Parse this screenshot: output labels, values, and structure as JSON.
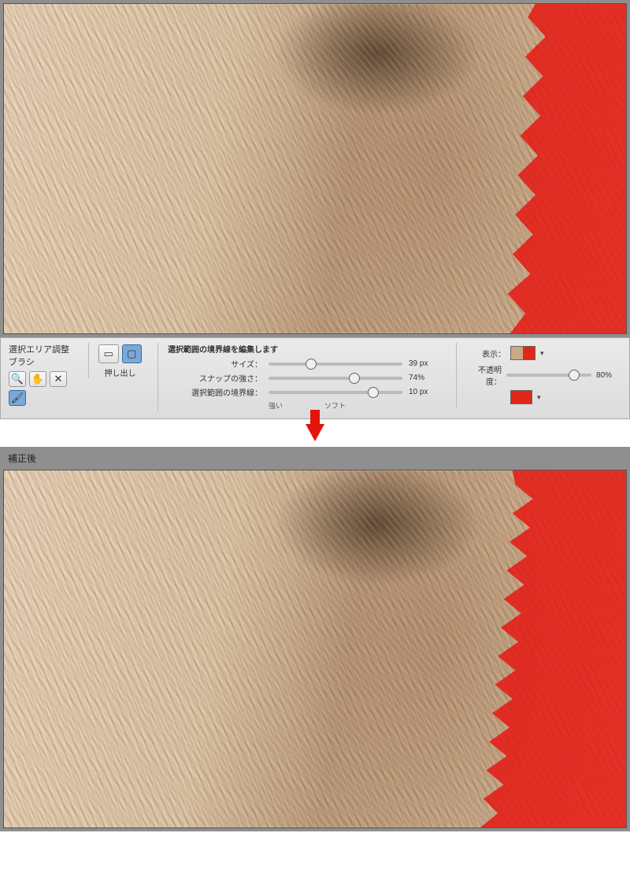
{
  "panel": {
    "title": "選択エリア調整ブラシ",
    "mode_label": "押し出し",
    "sliders_heading": "選択範囲の境界線を編集します",
    "size": {
      "label": "サイズ：",
      "value": "39 px",
      "pos": 32
    },
    "snap": {
      "label": "スナップの強さ：",
      "value": "74%",
      "pos": 64
    },
    "edge": {
      "label": "選択範囲の境界線：",
      "value": "10 px",
      "pos": 78
    },
    "end_low": "強い",
    "end_high": "ソフト",
    "display_label": "表示：",
    "opacity_label": "不透明度：",
    "opacity_value": "80%"
  },
  "after_label": "補正後",
  "icons": {
    "zoom": "🔍",
    "hand": "✋",
    "shuffle": "✕",
    "rectA": "▭",
    "rectB": "▢",
    "brush": "🖌"
  }
}
